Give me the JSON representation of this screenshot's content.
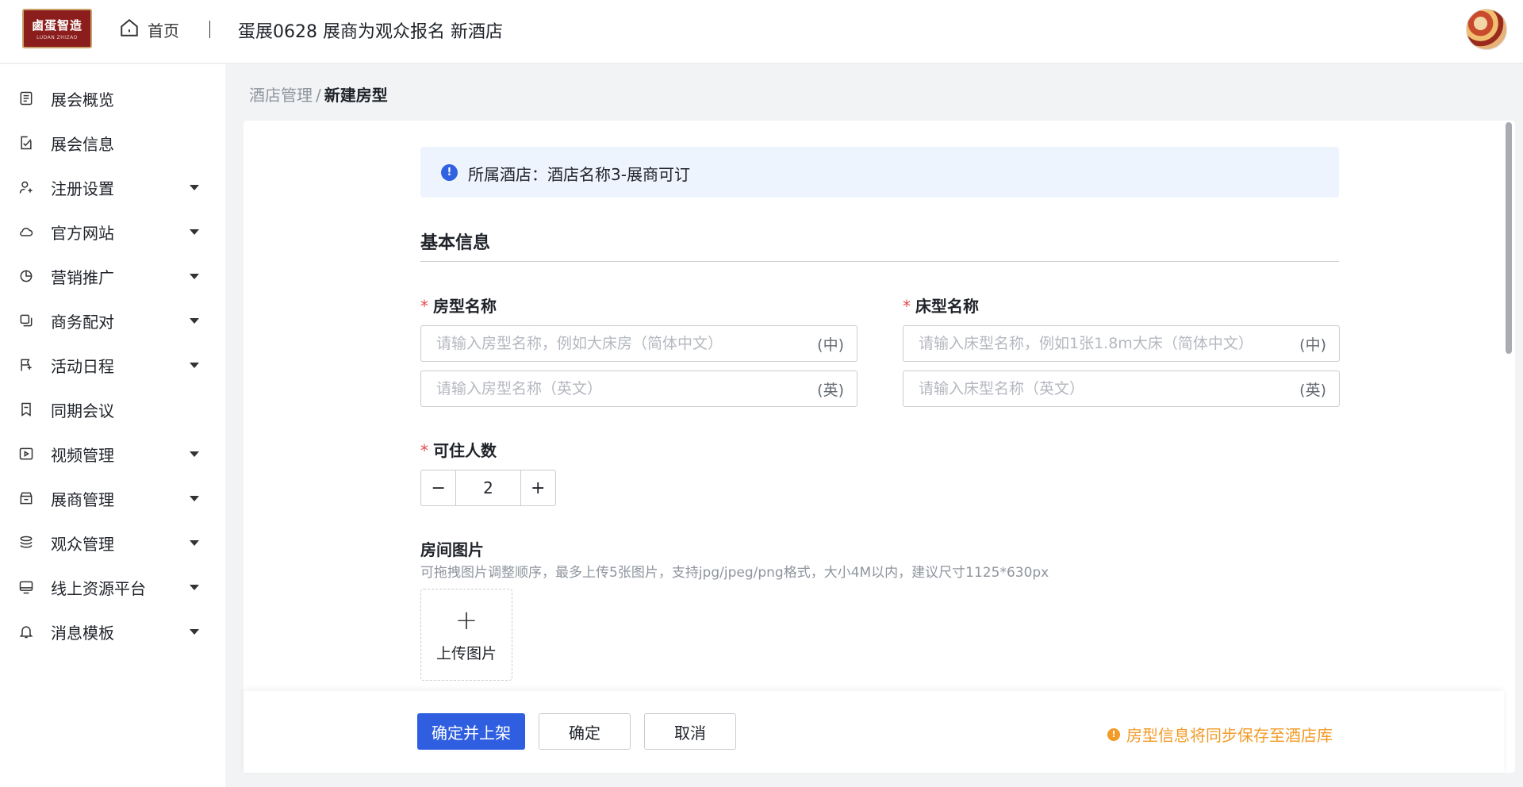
{
  "header": {
    "logo_text": "鹵蛋智造",
    "logo_subtext": "LUDAN ZHIZAO",
    "home_label": "首页",
    "title": "蛋展0628 展商为观众报名 新酒店"
  },
  "sidebar": {
    "items": [
      {
        "label": "展会概览",
        "icon": "overview-icon",
        "has_caret": false
      },
      {
        "label": "展会信息",
        "icon": "edit-doc-icon",
        "has_caret": false
      },
      {
        "label": "注册设置",
        "icon": "user-add-icon",
        "has_caret": true
      },
      {
        "label": "官方网站",
        "icon": "cloud-icon",
        "has_caret": true
      },
      {
        "label": "营销推广",
        "icon": "pie-chart-icon",
        "has_caret": true
      },
      {
        "label": "商务配对",
        "icon": "copy-icon",
        "has_caret": true
      },
      {
        "label": "活动日程",
        "icon": "flag-icon",
        "has_caret": true
      },
      {
        "label": "同期会议",
        "icon": "bookmark-icon",
        "has_caret": false
      },
      {
        "label": "视频管理",
        "icon": "play-icon",
        "has_caret": true
      },
      {
        "label": "展商管理",
        "icon": "store-icon",
        "has_caret": true
      },
      {
        "label": "观众管理",
        "icon": "stack-icon",
        "has_caret": true
      },
      {
        "label": "线上资源平台",
        "icon": "monitor-icon",
        "has_caret": true
      },
      {
        "label": "消息模板",
        "icon": "bell-icon",
        "has_caret": true
      }
    ]
  },
  "breadcrumb": {
    "parent": "酒店管理",
    "separator": "/",
    "current": "新建房型"
  },
  "info": {
    "text": "所属酒店：酒店名称3-展商可订"
  },
  "form": {
    "section_title": "基本信息",
    "room_name": {
      "label": "房型名称",
      "zh_placeholder": "请输入房型名称，例如大床房（简体中文）",
      "zh_suffix": "(中)",
      "en_placeholder": "请输入房型名称（英文）",
      "en_suffix": "(英)"
    },
    "bed_name": {
      "label": "床型名称",
      "zh_placeholder": "请输入床型名称，例如1张1.8m大床（简体中文）",
      "zh_suffix": "(中)",
      "en_placeholder": "请输入床型名称（英文）",
      "en_suffix": "(英)"
    },
    "capacity": {
      "label": "可住人数",
      "value": "2",
      "minus": "−",
      "plus": "+"
    },
    "images": {
      "label": "房间图片",
      "hint": "可拖拽图片调整顺序，最多上传5张图片，支持jpg/jpeg/png格式，大小4M以内，建议尺寸1125*630px",
      "upload_label": "上传图片"
    },
    "required_mark": "*"
  },
  "footer": {
    "publish_label": "确定并上架",
    "confirm_label": "确定",
    "cancel_label": "取消",
    "sync_note": "房型信息将同步保存至酒店库"
  },
  "colors": {
    "primary": "#2f5fe0",
    "warning": "#f29b27",
    "required": "#e5484d",
    "info_bg": "#eef4fe"
  }
}
